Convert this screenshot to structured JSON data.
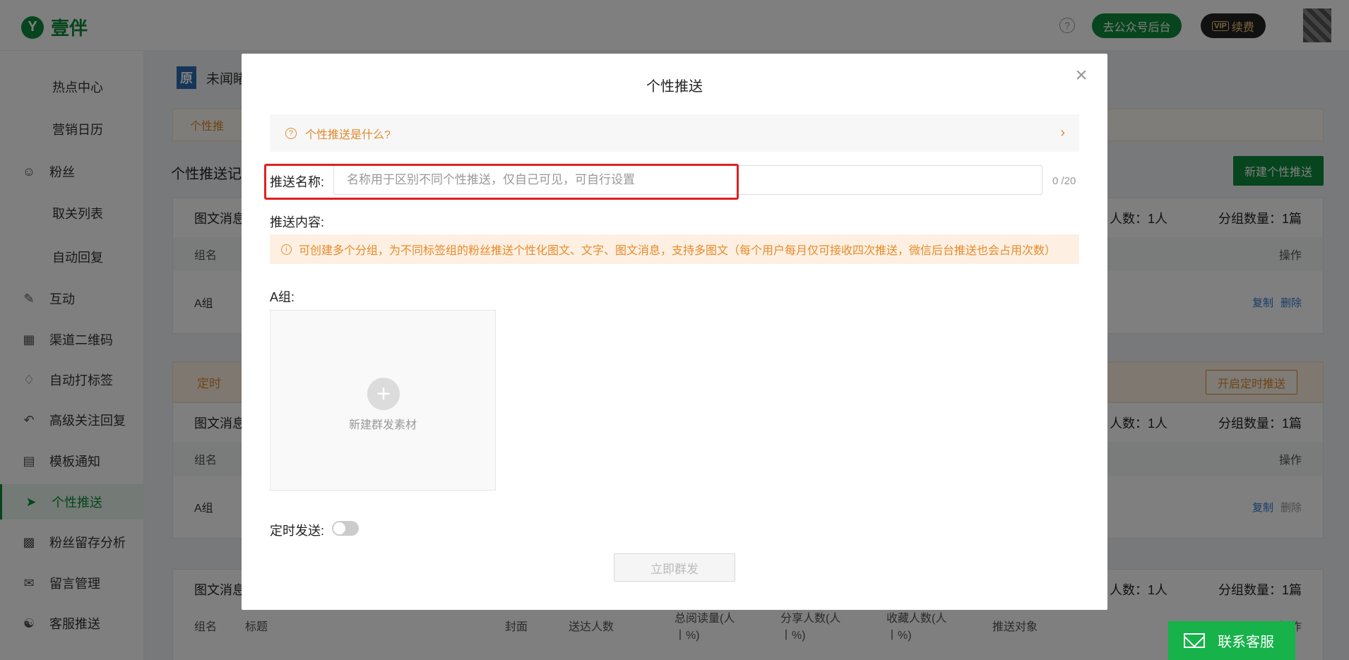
{
  "header": {
    "brand": "壹伴",
    "logo_char": "Y",
    "help_glyph": "?",
    "backend_button": "去公众号后台",
    "vip_tag": "VIP",
    "vip_label": "续费"
  },
  "sidebar": {
    "items": [
      {
        "label": "热点中心",
        "icon": "fire-icon"
      },
      {
        "label": "营销日历",
        "icon": "calendar-icon"
      },
      {
        "label": "粉丝",
        "icon": "user-icon"
      },
      {
        "label": "取关列表",
        "icon": ""
      },
      {
        "label": "自动回复",
        "icon": ""
      },
      {
        "label": "互动",
        "icon": "chat-icon"
      },
      {
        "label": "渠道二维码",
        "icon": "qrcode-icon"
      },
      {
        "label": "自动打标签",
        "icon": "tag-icon"
      },
      {
        "label": "高级关注回复",
        "icon": "reply-icon"
      },
      {
        "label": "模板通知",
        "icon": "document-icon"
      },
      {
        "label": "个性推送",
        "icon": "send-icon"
      },
      {
        "label": "粉丝留存分析",
        "icon": "chart-icon"
      },
      {
        "label": "留言管理",
        "icon": "message-icon"
      },
      {
        "label": "客服推送",
        "icon": "headset-icon"
      }
    ]
  },
  "main": {
    "account_name": "未闻睹",
    "account_logo_char": "原",
    "banner": "个性推",
    "section_title": "个性推送记",
    "new_button": "新建个性推送",
    "cards": [
      {
        "title": "图文消息",
        "count": "人数：1人",
        "groups": "分组数量：1篇",
        "col_group": "组名",
        "col_op": "操作",
        "row_group": "A组",
        "copy": "复制",
        "delete": "删除"
      },
      {
        "title": "图文消息",
        "count": "人数：1人",
        "groups": "分组数量：1篇",
        "col_group": "组名",
        "col_op": "操作",
        "row_group": "A组",
        "copy": "复制",
        "delete": "删除"
      },
      {
        "title": "图文消息",
        "count": "人数：1人",
        "groups": "分组数量：1篇",
        "col_group": "组名",
        "col_title": "标题",
        "col_cover": "封面",
        "col_sent": "送达人数",
        "col_reads": "总阅读量(人丨%)",
        "col_shares": "分享人数(人丨%)",
        "col_favs": "收藏人数(人丨%)",
        "col_target": "推送对象",
        "col_op": "操作"
      }
    ],
    "timer_bar": "定时",
    "timer_button": "开启定时推送"
  },
  "modal": {
    "title": "个性推送",
    "close_glyph": "×",
    "help_text": "个性推送是什么?",
    "name_label": "推送名称:",
    "name_value": "",
    "name_placeholder": "名称用于区别不同个性推送，仅自己可见，可自行设置",
    "name_counter": "0 /20",
    "content_label": "推送内容:",
    "warning": "可创建多个分组，为不同标签组的粉丝推送个性化图文、文字、图文消息，支持多图文（每个用户每月仅可接收四次推送，微信后台推送也会占用次数）",
    "group_label": "A组:",
    "upload_text": "新建群发素材",
    "timer_label": "定时发送:",
    "timer_on": false,
    "send_button": "立即群发"
  },
  "contact": {
    "label": "联系客服"
  },
  "colors": {
    "brand_green": "#0c8a3a",
    "warning_orange": "#e08a2c",
    "highlight_red": "#e02020"
  }
}
